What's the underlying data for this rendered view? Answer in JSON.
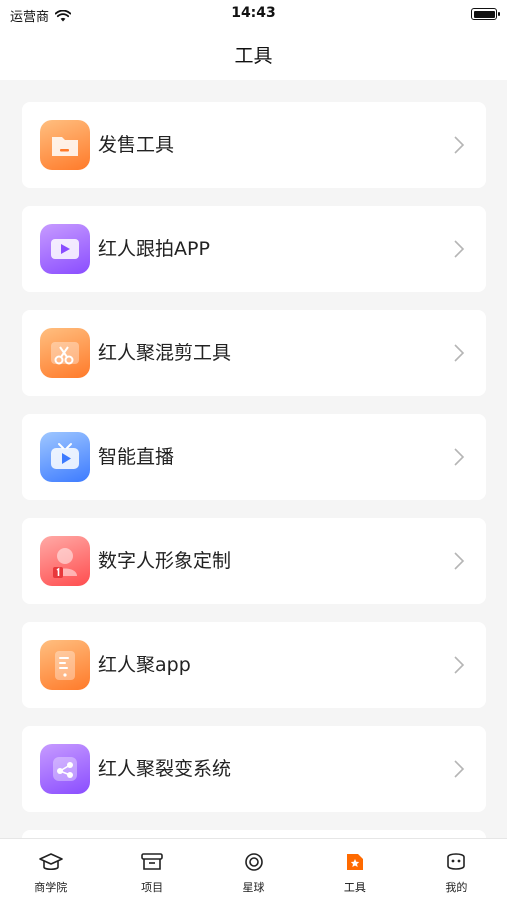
{
  "status": {
    "carrier": "运营商",
    "time": "14:43",
    "icons": [
      "wifi-icon",
      "battery-icon"
    ]
  },
  "header": {
    "title": "工具"
  },
  "tools": [
    {
      "label": "发售工具",
      "icon": "folder-icon",
      "color": "orange"
    },
    {
      "label": "红人跟拍APP",
      "icon": "video-icon",
      "color": "purple"
    },
    {
      "label": "红人聚混剪工具",
      "icon": "scissors-icon",
      "color": "orange"
    },
    {
      "label": "智能直播",
      "icon": "live-tv-icon",
      "color": "blue"
    },
    {
      "label": "数字人形象定制",
      "icon": "digital-human-icon",
      "color": "red"
    },
    {
      "label": "红人聚app",
      "icon": "phone-app-icon",
      "color": "orange"
    },
    {
      "label": "红人聚裂变系统",
      "icon": "share-icon",
      "color": "purple"
    }
  ],
  "tabbar": {
    "active": "工具",
    "accent": "#ff6a00",
    "items": [
      {
        "label": "商学院",
        "icon": "graduation-cap-icon"
      },
      {
        "label": "项目",
        "icon": "box-icon"
      },
      {
        "label": "星球",
        "icon": "planet-icon"
      },
      {
        "label": "工具",
        "icon": "tool-star-icon"
      },
      {
        "label": "我的",
        "icon": "profile-icon"
      }
    ]
  }
}
